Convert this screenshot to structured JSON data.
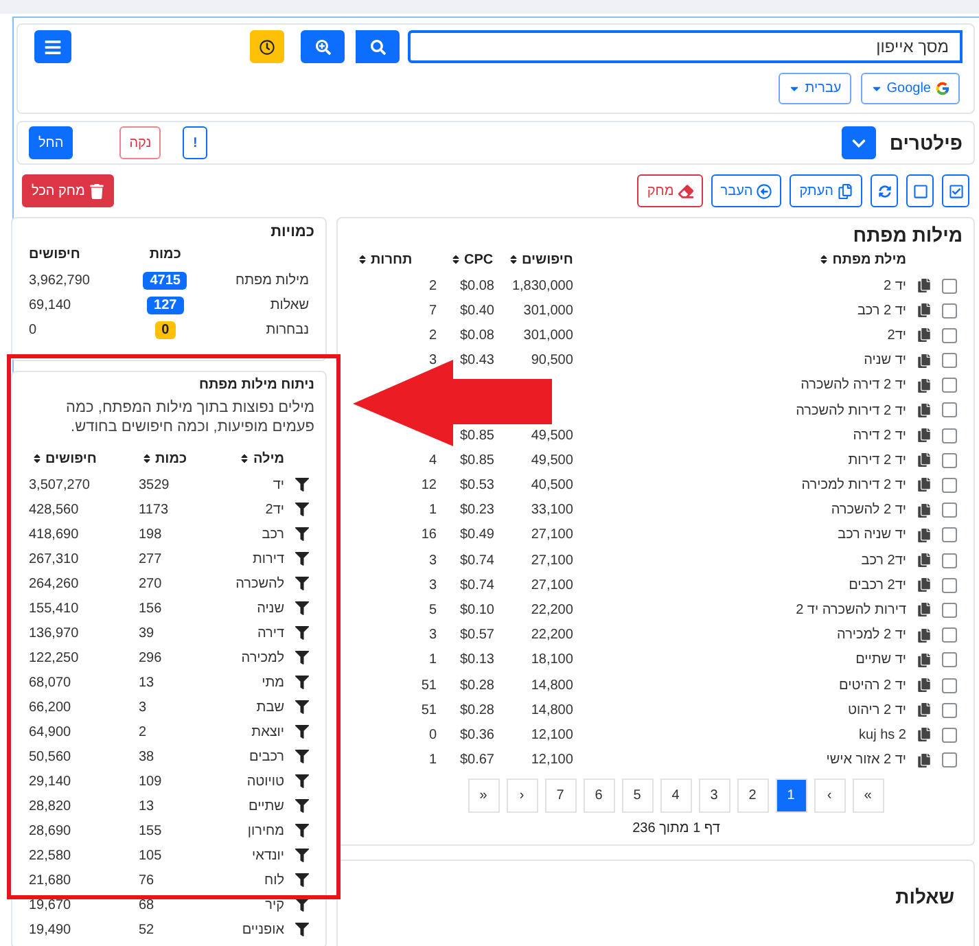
{
  "search": {
    "value": "מסך אייפון"
  },
  "engine_select": {
    "label": "Google"
  },
  "language_select": {
    "label": "עברית"
  },
  "filters": {
    "title": "פילטרים",
    "info_button": "!",
    "clear_button": "נקה",
    "apply_button": "החל"
  },
  "toolbar": {
    "copy_button": "העתק",
    "move_button": "העבר",
    "delete_button": "מחק",
    "delete_all_button": "מחק הכל"
  },
  "keywords": {
    "title": "מילות מפתח",
    "columns": [
      "מילת מפתח",
      "חיפושים",
      "CPC",
      "תחרות"
    ],
    "rows": [
      {
        "keyword": "יד 2",
        "searches": "1,830,000",
        "cpc": "$0.08",
        "competition": "2",
        "checked": false
      },
      {
        "keyword": "יד 2 רכב",
        "searches": "301,000",
        "cpc": "$0.40",
        "competition": "7",
        "checked": false
      },
      {
        "keyword": "יד2",
        "searches": "301,000",
        "cpc": "$0.08",
        "competition": "2",
        "checked": false
      },
      {
        "keyword": "יד שניה",
        "searches": "90,500",
        "cpc": "$0.43",
        "competition": "3",
        "checked": false
      },
      {
        "keyword": "יד 2 דירה להשכרה",
        "checked": false
      },
      {
        "keyword": "יד 2 דירות להשכרה",
        "checked": false
      },
      {
        "keyword": "יד 2 דירה",
        "searches": "49,500",
        "cpc": "$0.85",
        "checked": false
      },
      {
        "keyword": "יד 2 דירות",
        "searches": "49,500",
        "cpc": "$0.85",
        "competition": "4",
        "checked": false
      },
      {
        "keyword": "יד 2 דירות למכירה",
        "searches": "40,500",
        "cpc": "$0.53",
        "competition": "12",
        "checked": false
      },
      {
        "keyword": "יד 2 להשכרה",
        "searches": "33,100",
        "cpc": "$0.23",
        "competition": "1",
        "checked": false
      },
      {
        "keyword": "יד שניה רכב",
        "searches": "27,100",
        "cpc": "$0.49",
        "competition": "16",
        "checked": false
      },
      {
        "keyword": "יד2 רכב",
        "searches": "27,100",
        "cpc": "$0.74",
        "competition": "3",
        "checked": false
      },
      {
        "keyword": "יד2 רכבים",
        "searches": "27,100",
        "cpc": "$0.74",
        "competition": "3",
        "checked": false
      },
      {
        "keyword": "דירות להשכרה יד 2",
        "searches": "22,200",
        "cpc": "$0.10",
        "competition": "5",
        "checked": false
      },
      {
        "keyword": "יד 2 למכירה",
        "searches": "22,200",
        "cpc": "$0.57",
        "competition": "3",
        "checked": false
      },
      {
        "keyword": "יד שתיים",
        "searches": "18,100",
        "cpc": "$0.13",
        "competition": "1",
        "checked": false
      },
      {
        "keyword": "יד 2 רהיטים",
        "searches": "14,800",
        "cpc": "$0.28",
        "competition": "51",
        "checked": false
      },
      {
        "keyword": "יד 2 ריהוט",
        "searches": "14,800",
        "cpc": "$0.28",
        "competition": "51",
        "checked": false
      },
      {
        "keyword": "kuj hs 2",
        "searches": "12,100",
        "cpc": "$0.36",
        "competition": "0",
        "checked": false
      },
      {
        "keyword": "יד 2 אזור אישי",
        "searches": "12,100",
        "cpc": "$0.67",
        "competition": "1",
        "checked": false
      }
    ],
    "pagination": [
      {
        "label": "»",
        "selected": false
      },
      {
        "label": "›",
        "selected": false
      },
      {
        "label": "1",
        "selected": true
      },
      {
        "label": "2",
        "selected": false
      },
      {
        "label": "3",
        "selected": false
      },
      {
        "label": "4",
        "selected": false
      },
      {
        "label": "5",
        "selected": false
      },
      {
        "label": "6",
        "selected": false
      },
      {
        "label": "7",
        "selected": false
      },
      {
        "label": "‹",
        "selected": false
      },
      {
        "label": "«",
        "selected": false
      }
    ],
    "page_info": "דף 1 מתוך 236"
  },
  "quantities": {
    "title": "כמויות",
    "columns": [
      "כמות",
      "חיפושים"
    ],
    "rows": [
      {
        "label": "מילות מפתח",
        "count": "4715",
        "searches": "3,962,790",
        "color": "#0d6efd"
      },
      {
        "label": "שאלות",
        "count": "127",
        "searches": "69,140",
        "color": "#0d6efd"
      },
      {
        "label": "נבחרות",
        "count": "0",
        "searches": "0",
        "color": "#ffc107"
      }
    ]
  },
  "analysis": {
    "title": "ניתוח מילות מפתח",
    "description": "מילים נפוצות בתוך מילות המפתח, כמה פעמים מופיעות, וכמה חיפושים בחודש.",
    "columns": [
      "מילה",
      "כמות",
      "חיפושים"
    ],
    "rows": [
      {
        "word": "יד",
        "count": "3529",
        "searches": "3,507,270"
      },
      {
        "word": "יד2",
        "count": "1173",
        "searches": "428,560"
      },
      {
        "word": "רכב",
        "count": "198",
        "searches": "418,690"
      },
      {
        "word": "דירות",
        "count": "277",
        "searches": "267,310"
      },
      {
        "word": "להשכרה",
        "count": "270",
        "searches": "264,260"
      },
      {
        "word": "שניה",
        "count": "156",
        "searches": "155,410"
      },
      {
        "word": "דירה",
        "count": "39",
        "searches": "136,970"
      },
      {
        "word": "למכירה",
        "count": "296",
        "searches": "122,250"
      },
      {
        "word": "מתי",
        "count": "13",
        "searches": "68,070"
      },
      {
        "word": "שבת",
        "count": "3",
        "searches": "66,200"
      },
      {
        "word": "יוצאת",
        "count": "2",
        "searches": "64,900"
      },
      {
        "word": "רכבים",
        "count": "38",
        "searches": "50,560"
      },
      {
        "word": "טויוטה",
        "count": "109",
        "searches": "29,140"
      },
      {
        "word": "שתיים",
        "count": "13",
        "searches": "28,820"
      },
      {
        "word": "מחירון",
        "count": "155",
        "searches": "28,690"
      },
      {
        "word": "יונדאי",
        "count": "105",
        "searches": "22,580"
      },
      {
        "word": "לוח",
        "count": "76",
        "searches": "21,680"
      },
      {
        "word": "קיר",
        "count": "68",
        "searches": "19,670"
      },
      {
        "word": "אופניים",
        "count": "52",
        "searches": "19,490"
      }
    ]
  },
  "questions": {
    "title": "שאלות"
  }
}
